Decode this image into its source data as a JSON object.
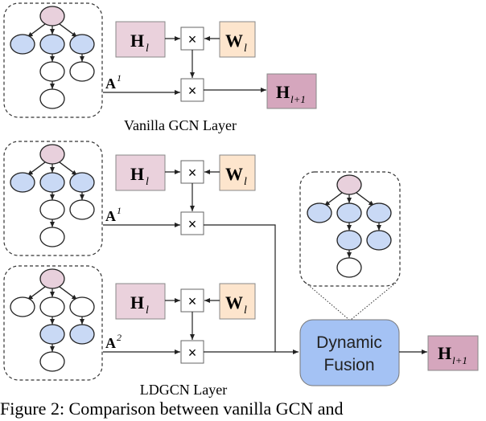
{
  "colors": {
    "root_node": "#e8d0dc",
    "active_node": "#c9d9f5",
    "inactive_node": "#ffffff",
    "h_box": "#ead1dc",
    "w_box": "#fde5cd",
    "h_next_box": "#d5a6bd",
    "fusion_box": "#a4c2f4"
  },
  "vanilla": {
    "caption": "Vanilla GCN Layer",
    "h_label": "H",
    "h_sub": "l",
    "w_label": "W",
    "w_sub": "l",
    "mult_symbol": "×",
    "adj_label": "A",
    "adj_sup": "1",
    "out_label": "H",
    "out_sub": "l+1",
    "graph_active": [
      false,
      true,
      true,
      true,
      false,
      false,
      false
    ]
  },
  "ldgcn": {
    "caption": "LDGCN Layer",
    "branch1": {
      "h_label": "H",
      "h_sub": "l",
      "w_label": "W",
      "w_sub": "l",
      "mult_symbol": "×",
      "adj_label": "A",
      "adj_sup": "1",
      "graph_active": [
        false,
        true,
        true,
        true,
        false,
        false,
        false
      ]
    },
    "branch2": {
      "h_label": "H",
      "h_sub": "l",
      "w_label": "W",
      "w_sub": "l",
      "mult_symbol": "×",
      "adj_label": "A",
      "adj_sup": "2",
      "graph_active": [
        false,
        false,
        false,
        false,
        true,
        true,
        false
      ]
    },
    "fusion_label_line1": "Dynamic",
    "fusion_label_line2": "Fusion",
    "fused_graph_active": [
      false,
      true,
      true,
      true,
      true,
      true,
      false
    ],
    "out_label": "H",
    "out_sub": "l+1"
  },
  "figure_caption": "Figure 2:  Comparison between vanilla GCN and"
}
